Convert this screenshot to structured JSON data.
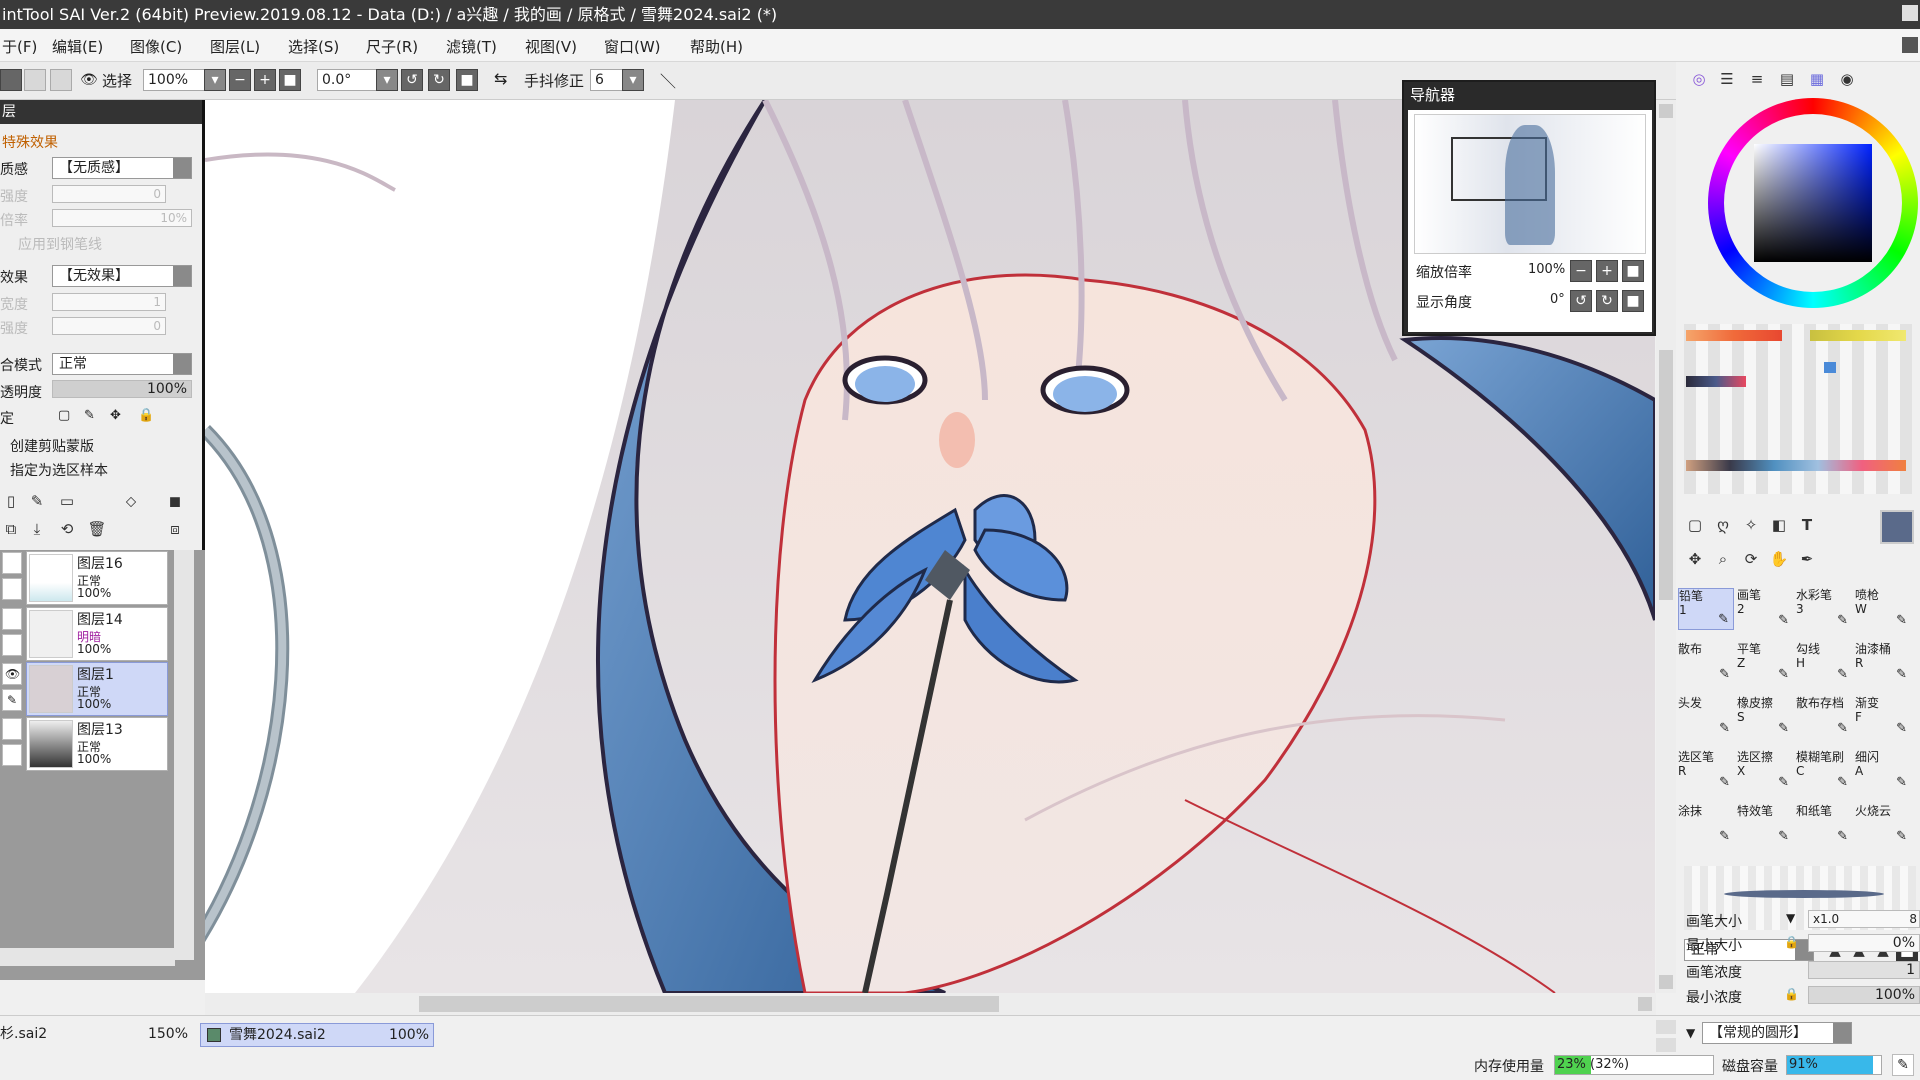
{
  "titlebar": {
    "title": "intTool SAI Ver.2 (64bit) Preview.2019.08.12 - Data (D:) / a兴趣 / 我的画 / 原格式 / 雪舞2024.sai2 (*)"
  },
  "menu": [
    "于(F)",
    "编辑(E)",
    "图像(C)",
    "图层(L)",
    "选择(S)",
    "尺子(R)",
    "滤镜(T)",
    "视图(V)",
    "窗口(W)",
    "帮助(H)"
  ],
  "toolbar": {
    "select_label": "选择",
    "zoom": "100%",
    "angle": "0.0°",
    "stabilizer_label": "手抖修正",
    "stabilizer_value": "6"
  },
  "layer_panel": {
    "header": "层",
    "special_effects": "特殊效果",
    "texture_label": "质感",
    "texture_value": "【无质感】",
    "scale_label": "强度",
    "scale_value": "0",
    "rate_label": "倍率",
    "rate_value": "10%",
    "apply_pen": "应用到钢笔线",
    "effect_label": "效果",
    "effect_value": "【无效果】",
    "width_label": "宽度",
    "width_value": "1",
    "strength_label": "强度",
    "strength_value": "0",
    "blend_label": "合模式",
    "blend_value": "正常",
    "opacity_label": "透明度",
    "opacity_value": "100%",
    "lock_label": "定",
    "clip_group": "创建剪贴蒙版",
    "selection_source": "指定为选区样本",
    "layers": [
      {
        "name": "图层16",
        "mode": "正常",
        "opacity": "100%"
      },
      {
        "name": "图层14",
        "mode": "明暗",
        "opacity": "100%"
      },
      {
        "name": "图层1",
        "mode": "正常",
        "opacity": "100%"
      },
      {
        "name": "图层13",
        "mode": "正常",
        "opacity": "100%"
      }
    ]
  },
  "navigator": {
    "title": "导航器",
    "zoom_label": "缩放倍率",
    "zoom_value": "100%",
    "angle_label": "显示角度",
    "angle_value": "0°"
  },
  "tools": {
    "brushes": [
      {
        "name": "铅笔",
        "key": "1"
      },
      {
        "name": "画笔",
        "key": "2"
      },
      {
        "name": "水彩笔",
        "key": "3"
      },
      {
        "name": "喷枪",
        "key": "W"
      },
      {
        "name": "散布",
        "key": ""
      },
      {
        "name": "平笔",
        "key": "Z"
      },
      {
        "name": "勾线",
        "key": "H"
      },
      {
        "name": "油漆桶",
        "key": "R"
      },
      {
        "name": "头发",
        "key": ""
      },
      {
        "name": "橡皮擦",
        "key": "S"
      },
      {
        "name": "散布存档",
        "key": ""
      },
      {
        "name": "渐变",
        "key": "F"
      },
      {
        "name": "选区笔",
        "key": "R"
      },
      {
        "name": "选区擦",
        "key": "X"
      },
      {
        "name": "模糊笔刷",
        "key": "C"
      },
      {
        "name": "细闪",
        "key": "A"
      },
      {
        "name": "涂抹",
        "key": ""
      },
      {
        "name": "特效笔",
        "key": ""
      },
      {
        "name": "和纸笔",
        "key": ""
      },
      {
        "name": "火烧云",
        "key": ""
      }
    ],
    "blend_mode": "正常",
    "brush_size_label": "画笔大小",
    "brush_size_mult": "x1.0",
    "brush_size_value": "8",
    "min_size_label": "最小大小",
    "min_size_value": "0%",
    "density_label": "画笔浓度",
    "density_value": "1",
    "min_density_label": "最小浓度",
    "min_density_value": "100%",
    "shape_value": "【常规的圆形】"
  },
  "status": {
    "tab1_name": "杉.sai2",
    "tab1_zoom": "150%",
    "tab2_name": "雪舞2024.sai2",
    "tab2_zoom": "100%",
    "memory_label": "内存使用量",
    "memory_value": "23% (32%)",
    "memory_fraction": 0.23,
    "disk_label": "磁盘容量",
    "disk_value": "91%",
    "disk_fraction": 0.91
  },
  "colors": {
    "accent": "#cfd8f7",
    "titlebar": "#3a3a3a"
  }
}
